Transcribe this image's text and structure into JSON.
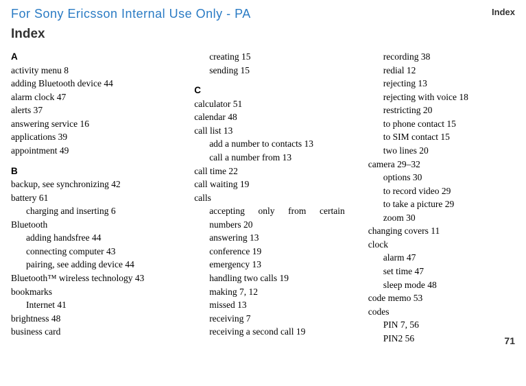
{
  "header": "For Sony Ericsson Internal Use Only - PA",
  "page_label": "Index",
  "heading": "Index",
  "page_number": "71",
  "col1": {
    "A": "A",
    "a1": "activity menu 8",
    "a2": "adding Bluetooth device 44",
    "a3": "alarm clock 47",
    "a4": "alerts 37",
    "a5": "answering service 16",
    "a6": "applications 39",
    "a7": "appointment 49",
    "B": "B",
    "b1": "backup, see synchronizing 42",
    "b2": "battery 61",
    "b2a": "charging and inserting 6",
    "b3": "Bluetooth",
    "b3a": "adding handsfree 44",
    "b3b": "connecting computer 43",
    "b3c": "pairing, see adding device 44",
    "b4": "Bluetooth™ wireless technology 43",
    "b5": "bookmarks",
    "b5a": "Internet 41",
    "b6": "brightness 48",
    "b7": "business card"
  },
  "col2": {
    "bc1": "creating 15",
    "bc2": "sending 15",
    "C": "C",
    "c1": "calculator 51",
    "c2": "calendar 48",
    "c3": "call list 13",
    "c3a": "add a number to contacts 13",
    "c3b": "call a number from 13",
    "c4": "call time 22",
    "c5": "call waiting 19",
    "c6": "calls",
    "c6a": "accepting only from certain numbers 20",
    "c6b": "answering 13",
    "c6c": "conference 19",
    "c6d": "emergency 13",
    "c6e": "handling two calls 19",
    "c6f": "making 7, 12",
    "c6g": "missed 13",
    "c6h": "receiving 7",
    "c6i": "receiving a second call 19"
  },
  "col3": {
    "d1": "recording 38",
    "d2": "redial 12",
    "d3": "rejecting 13",
    "d4": "rejecting with voice 18",
    "d5": "restricting 20",
    "d6": "to phone contact 15",
    "d7": "to SIM contact 15",
    "d8": "two lines 20",
    "e1": "camera 29–32",
    "e1a": "options 30",
    "e1b": "to record video 29",
    "e1c": "to take a picture 29",
    "e1d": "zoom 30",
    "f1": "changing covers 11",
    "g1": "clock",
    "g1a": "alarm 47",
    "g1b": "set time 47",
    "g1c": "sleep mode 48",
    "h1": "code memo 53",
    "i1": "codes",
    "i1a": "PIN 7, 56",
    "i1b": "PIN2 56"
  }
}
